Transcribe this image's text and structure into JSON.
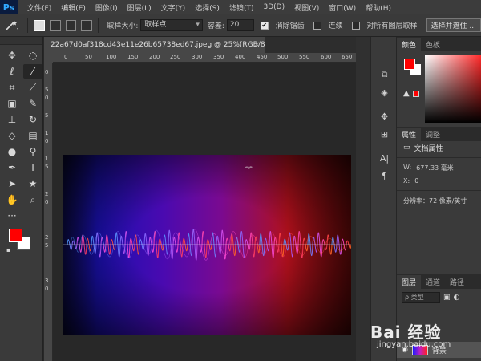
{
  "app": {
    "logo": "Ps"
  },
  "menubar": {
    "items": [
      "文件(F)",
      "编辑(E)",
      "图像(I)",
      "图层(L)",
      "文字(Y)",
      "选择(S)",
      "滤镜(T)",
      "3D(D)",
      "视图(V)",
      "窗口(W)",
      "帮助(H)"
    ]
  },
  "options": {
    "sample_size_label": "取样大小:",
    "sample_size_value": "取样点",
    "tolerance_label": "容差:",
    "tolerance_value": "20",
    "antialias_label": "消除锯齿",
    "contiguous_label": "连续",
    "sample_all_label": "对所有图层取样",
    "select_subject_label": "选择并遮住 ..."
  },
  "document": {
    "tab_title": "22a67d0af318cd43e11e26b65738ed67.jpeg @ 25%(RGB/8#)",
    "close_glyph": "×",
    "ruler_top": [
      "0",
      "50",
      "100",
      "150",
      "200",
      "250",
      "300",
      "350",
      "400",
      "450",
      "500",
      "550",
      "600",
      "650"
    ],
    "ruler_left": [
      "0",
      "5",
      "0",
      "5",
      "1",
      "0",
      "1",
      "5",
      "2",
      "0",
      "2",
      "5",
      "3",
      "0"
    ]
  },
  "panels": {
    "color_tabs": [
      "颜色",
      "色板"
    ],
    "props_tabs": [
      "属性",
      "调整"
    ],
    "doc_props_label": "文档属性",
    "width_label": "W:",
    "width_value": "677.33 毫米",
    "x_label": "X:",
    "x_value": "0",
    "resolution_text": "分辨率：72 像素/英寸",
    "layer_tabs": [
      "图层",
      "通道",
      "路径"
    ],
    "kind_placeholder": "ρ 类型",
    "layer_name": "背景"
  },
  "colors": {
    "foreground": "#ff0000",
    "background": "#ffffff",
    "accent": "#31a8ff"
  },
  "icons": [
    "magic-wand-icon",
    "move-icon",
    "marquee-icon",
    "lasso-icon",
    "crop-icon",
    "eyedropper-icon",
    "healing-brush-icon",
    "brush-icon",
    "clone-stamp-icon",
    "history-brush-icon",
    "eraser-icon",
    "gradient-icon",
    "blur-icon",
    "dodge-icon",
    "pen-icon",
    "type-icon",
    "path-select-icon",
    "shape-icon",
    "hand-icon",
    "zoom-icon"
  ],
  "watermark": {
    "logo": "Bai 经验",
    "url": "jingyan.baidu.com"
  }
}
